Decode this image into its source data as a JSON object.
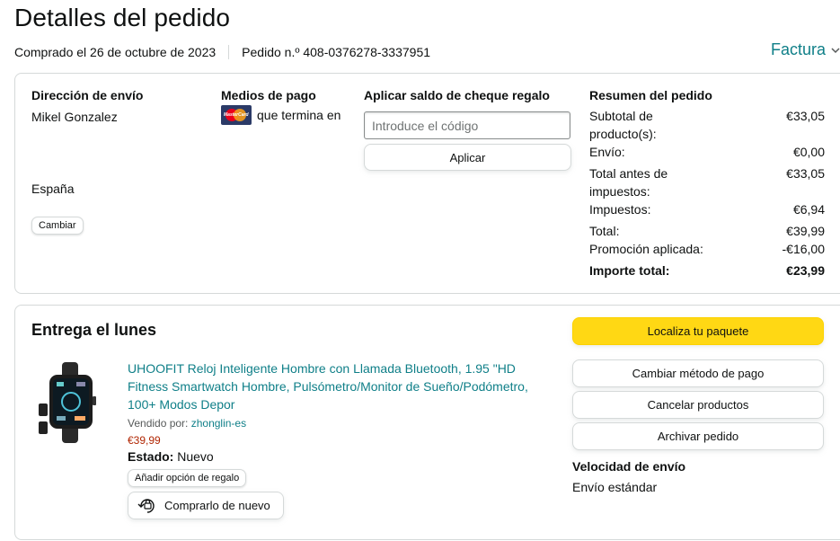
{
  "header": {
    "title": "Detalles del pedido",
    "purchased": "Comprado el 26 de octubre de 2023",
    "order_number": "Pedido n.º 408-0376278-3337951",
    "invoice_label": "Factura"
  },
  "shipping": {
    "title": "Dirección de envío",
    "name": "Mikel Gonzalez",
    "country": "España",
    "change_label": "Cambiar"
  },
  "payment": {
    "title": "Medios de pago",
    "card_brand": "mastercard-icon",
    "card_logo_text": "MasterCard",
    "card_text": "que termina en"
  },
  "gift_card": {
    "title": "Aplicar saldo de cheque regalo",
    "placeholder": "Introduce el código",
    "value": "",
    "apply_label": "Aplicar"
  },
  "summary": {
    "title": "Resumen del pedido",
    "rows": [
      {
        "label": "Subtotal de producto(s):",
        "value": "€33,05"
      },
      {
        "label": "Envío:",
        "value": "€0,00"
      },
      {
        "label": "Total antes de impuestos:",
        "value": "€33,05"
      },
      {
        "label": "Impuestos:",
        "value": "€6,94"
      },
      {
        "label": "Total:",
        "value": "€39,99"
      },
      {
        "label": "Promoción aplicada:",
        "value": "-€16,00"
      }
    ],
    "grand_total_label": "Importe total:",
    "grand_total_value": "€23,99"
  },
  "delivery": {
    "title": "Entrega el lunes",
    "product": {
      "title": "UHOOFIT Reloj Inteligente Hombre con Llamada Bluetooth, 1.95 \"HD Fitness Smartwatch Hombre, Pulsómetro/Monitor de Sueño/Podómetro, 100+ Modos Depor",
      "sold_by_label": "Vendido por:",
      "seller": "zhonglin-es",
      "price": "€39,99",
      "status_label": "Estado:",
      "status_value": "Nuevo",
      "gift_option_label": "Añadir opción de regalo",
      "rebuy_label": "Comprarlo de nuevo"
    },
    "actions": {
      "track": "Localiza tu paquete",
      "change_payment": "Cambiar método de pago",
      "cancel": "Cancelar productos",
      "archive": "Archivar pedido"
    },
    "speed_title": "Velocidad de envío",
    "speed_value": "Envío estándar"
  },
  "colors": {
    "link": "#0f7f88",
    "price": "#b12704",
    "primary_button": "#ffd814",
    "border": "#d5d9d9"
  }
}
